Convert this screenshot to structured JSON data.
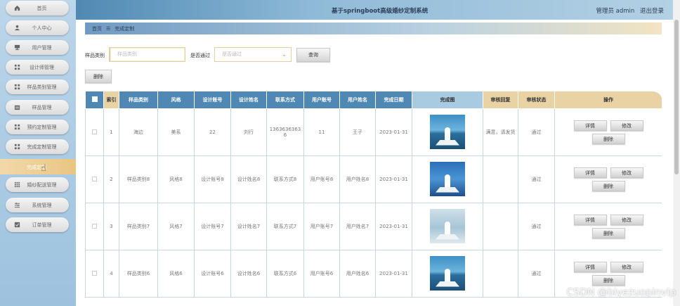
{
  "header": {
    "title": "基于springboot高级婚纱定制系统",
    "user": "管理员 admin",
    "logout": "退出登录"
  },
  "sidebar": {
    "items": [
      {
        "label": "首页",
        "icon": "home-icon"
      },
      {
        "label": "个人中心",
        "icon": "user-icon"
      },
      {
        "label": "用户管理",
        "icon": "monitor-icon"
      },
      {
        "label": "设计师管理",
        "icon": "grid-icon"
      },
      {
        "label": "样品类别管理",
        "icon": "grid-icon"
      },
      {
        "label": "样品管理",
        "icon": "calendar-icon"
      },
      {
        "label": "预约定制管理",
        "icon": "grid-icon"
      },
      {
        "label": "完成定制管理",
        "icon": "grid-icon"
      },
      {
        "label": "婚纱配送管理",
        "icon": "grid-icon"
      },
      {
        "label": "系统管理",
        "icon": "sliders-icon"
      },
      {
        "label": "订单管理",
        "icon": "checkbox-icon"
      }
    ],
    "active_sub": "完成定制"
  },
  "breadcrumb": {
    "home": "首页",
    "current": "完成定制"
  },
  "search": {
    "category_label": "样品类别",
    "category_placeholder": "样品类别",
    "pass_label": "是否通过",
    "pass_placeholder": "是否通过",
    "query_button": "查询"
  },
  "toolbar": {
    "delete_button": "删除"
  },
  "table": {
    "columns": [
      "索引",
      "样品类别",
      "风格",
      "设计账号",
      "设计姓名",
      "联系方式",
      "用户账号",
      "用户姓名",
      "完成日期",
      "完成图",
      "审核回复",
      "审核状态",
      "操作"
    ],
    "rows": [
      {
        "index": "1",
        "category": "海边",
        "style": "美系",
        "designer_account": "22",
        "designer_name": "刘行",
        "contact": "13636363636",
        "user_account": "11",
        "user_name": "王子",
        "date": "2023-01-31",
        "reply": "满意，请发货",
        "status": "通过",
        "image": "sea"
      },
      {
        "index": "2",
        "category": "样品类别8",
        "style": "风格8",
        "designer_account": "设计账号8",
        "designer_name": "设计姓名8",
        "contact": "联系方式8",
        "user_account": "用户账号8",
        "user_name": "用户姓名8",
        "date": "2023-01-31",
        "reply": "",
        "status": "通过",
        "image": "dusk"
      },
      {
        "index": "3",
        "category": "样品类别7",
        "style": "风格7",
        "designer_account": "设计账号7",
        "designer_name": "设计姓名7",
        "contact": "联系方式7",
        "user_account": "用户账号7",
        "user_name": "用户姓名7",
        "date": "2023-01-31",
        "reply": "",
        "status": "通过",
        "image": "mist"
      },
      {
        "index": "4",
        "category": "样品类别6",
        "style": "风格6",
        "designer_account": "设计账号6",
        "designer_name": "设计姓名6",
        "contact": "联系方式6",
        "user_account": "用户账号6",
        "user_name": "用户姓名6",
        "date": "2023-01-31",
        "reply": "",
        "status": "通过",
        "image": "sea"
      }
    ],
    "actions": {
      "detail": "详情",
      "edit": "修改",
      "delete": "删除"
    }
  },
  "watermark": "CSDN @biyezuopinvip",
  "colors": {
    "header": "#4f89b3",
    "table_head": "#e9d3a4",
    "accent": "#e9c582"
  }
}
